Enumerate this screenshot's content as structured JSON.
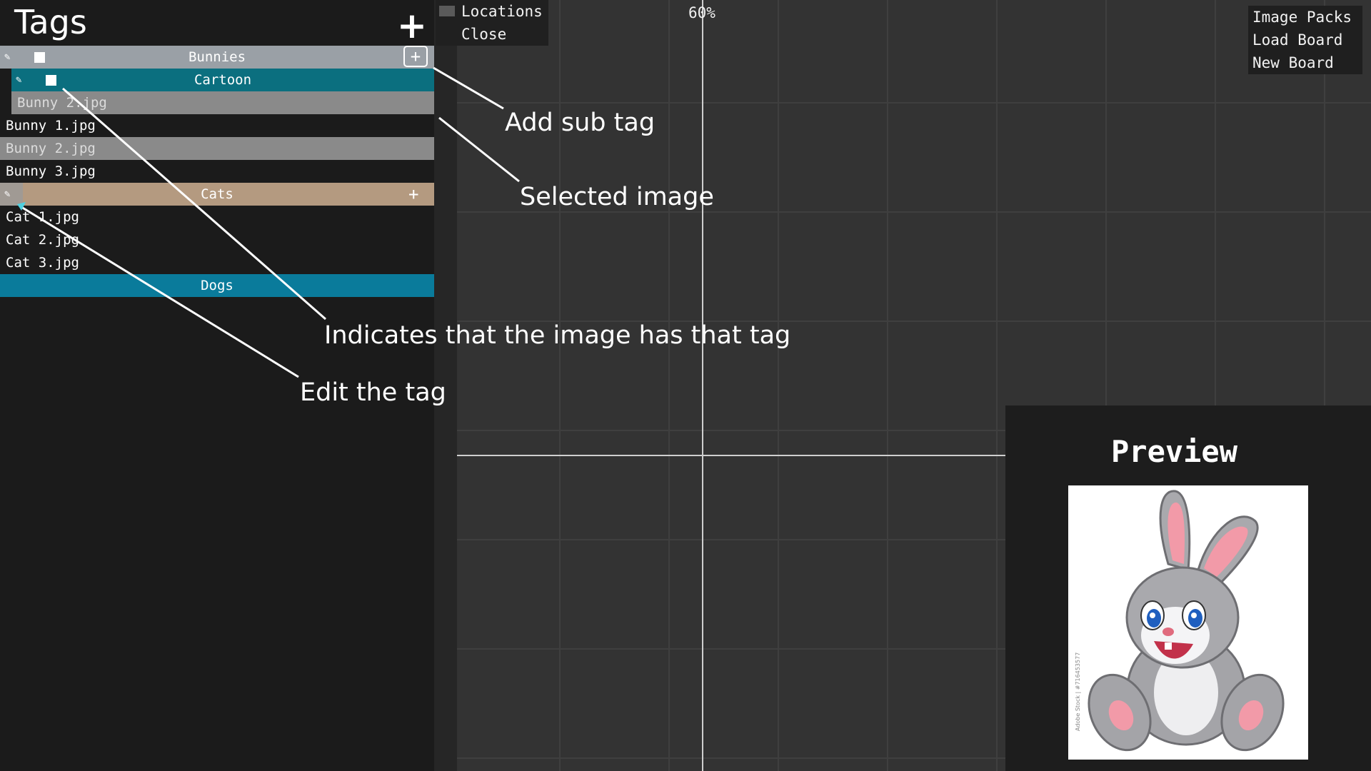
{
  "panel": {
    "title": "Tags",
    "add_icon": "plus-icon",
    "tags": [
      {
        "label": "Bunnies",
        "color": "#9aa0a6"
      },
      {
        "label": "Cartoon",
        "color": "#0b6f7f"
      },
      {
        "label": "Cats",
        "color": "#b49a80"
      },
      {
        "label": "Dogs",
        "color": "#0a7b9b"
      }
    ],
    "files": {
      "sub_selected": "Bunny 2.jpg",
      "bunny1": "Bunny 1.jpg",
      "bunny2": "Bunny 2.jpg",
      "bunny3": "Bunny 3.jpg",
      "cat1": "Cat 1.jpg",
      "cat2": "Cat 2.jpg",
      "cat3": "Cat 3.jpg"
    },
    "selected_row_color": "#8a8a8a"
  },
  "file_menu": {
    "items": [
      "Locations",
      "Close"
    ]
  },
  "top_menu": {
    "items": [
      "Image Packs",
      "Load Board",
      "New Board"
    ]
  },
  "canvas": {
    "zoom": "60%"
  },
  "preview": {
    "title": "Preview",
    "watermark": "Adobe Stock | #716453577"
  },
  "annotations": {
    "add_sub_tag": "Add sub tag",
    "selected_image": "Selected image",
    "has_tag": "Indicates that the image has that tag",
    "edit_tag": "Edit the tag"
  }
}
